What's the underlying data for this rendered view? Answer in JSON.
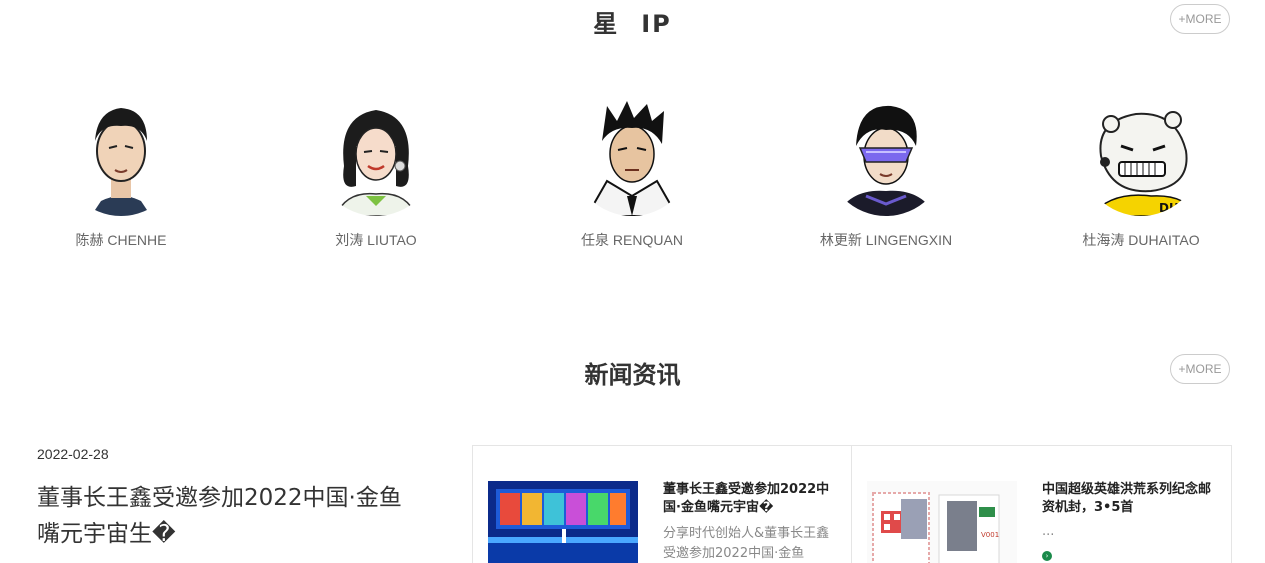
{
  "ip_section": {
    "title_left": "星",
    "title_right": "IP",
    "more_label": "+MORE",
    "cards": [
      {
        "name": "陈赫 CHENHE",
        "avatar_icon": "chenhe-portrait-icon"
      },
      {
        "name": "刘涛 LIUTAO",
        "avatar_icon": "liutao-portrait-icon"
      },
      {
        "name": "任泉 RENQUAN",
        "avatar_icon": "renquan-portrait-icon"
      },
      {
        "name": "林更新 LINGENGXIN",
        "avatar_icon": "lingengxin-portrait-icon"
      },
      {
        "name": "杜海涛 DUHAITAO",
        "avatar_icon": "duhaitao-bear-portrait-icon"
      }
    ]
  },
  "news_section": {
    "title": "新闻资讯",
    "more_label": "+MORE",
    "feature": {
      "date": "2022-02-28",
      "headline": "董事长王鑫受邀参加2022中国·金鱼嘴元宇宙生�"
    },
    "items": [
      {
        "title": "董事长王鑫受邀参加2022中国·金鱼嘴元宇宙�",
        "summary": "分享时代创始人&董事长王鑫受邀参加2022中国·金鱼",
        "thumb_icon": "conference-stage-thumbnail"
      },
      {
        "title": "中国超级英雄洪荒系列纪念邮资机封，3•5首",
        "summary": "...",
        "thumb_icon": "postal-cover-stamp-thumbnail"
      }
    ]
  },
  "colors": {
    "heading": "#333333",
    "muted": "#999999",
    "accent_green": "#1a8a4a"
  }
}
